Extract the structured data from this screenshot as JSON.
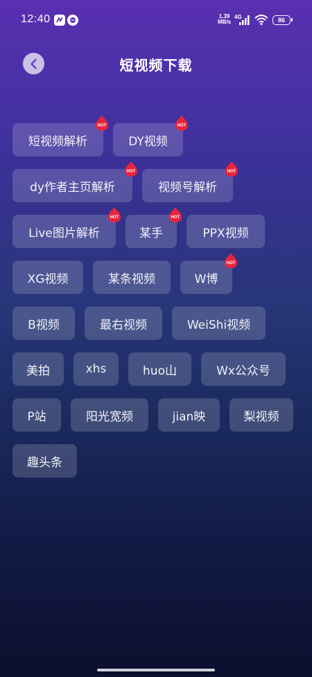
{
  "status_bar": {
    "time": "12:40",
    "net_speed_value": "1.39",
    "net_speed_unit": "MB/s",
    "network": "4G",
    "battery": "86"
  },
  "header": {
    "title": "短视频下载",
    "back_icon": "chevron-left-icon"
  },
  "colors": {
    "accent": "#e8243c",
    "chip_bg": "rgba(255,255,255,0.17)",
    "back_button_bg": "#c9c1e6"
  },
  "hot_label": "HOT",
  "chips": [
    {
      "label": "短视频解析",
      "hot": true
    },
    {
      "label": "DY视频",
      "hot": true
    },
    {
      "label": "dy作者主页解析",
      "hot": true
    },
    {
      "label": "视频号解析",
      "hot": true
    },
    {
      "label": "Live图片解析",
      "hot": true
    },
    {
      "label": "某手",
      "hot": true
    },
    {
      "label": "PPX视频",
      "hot": false
    },
    {
      "label": "XG视频",
      "hot": false
    },
    {
      "label": "某条视频",
      "hot": false
    },
    {
      "label": "W博",
      "hot": true
    },
    {
      "label": "B视频",
      "hot": false
    },
    {
      "label": "最右视频",
      "hot": false
    },
    {
      "label": "WeiShi视频",
      "hot": false
    },
    {
      "label": "美拍",
      "hot": false
    },
    {
      "label": "xhs",
      "hot": false
    },
    {
      "label": "huo山",
      "hot": false
    },
    {
      "label": "Wx公众号",
      "hot": false
    },
    {
      "label": "P站",
      "hot": false
    },
    {
      "label": "阳光宽频",
      "hot": false
    },
    {
      "label": "jian映",
      "hot": false
    },
    {
      "label": "梨视频",
      "hot": false
    },
    {
      "label": "趣头条",
      "hot": false
    }
  ]
}
